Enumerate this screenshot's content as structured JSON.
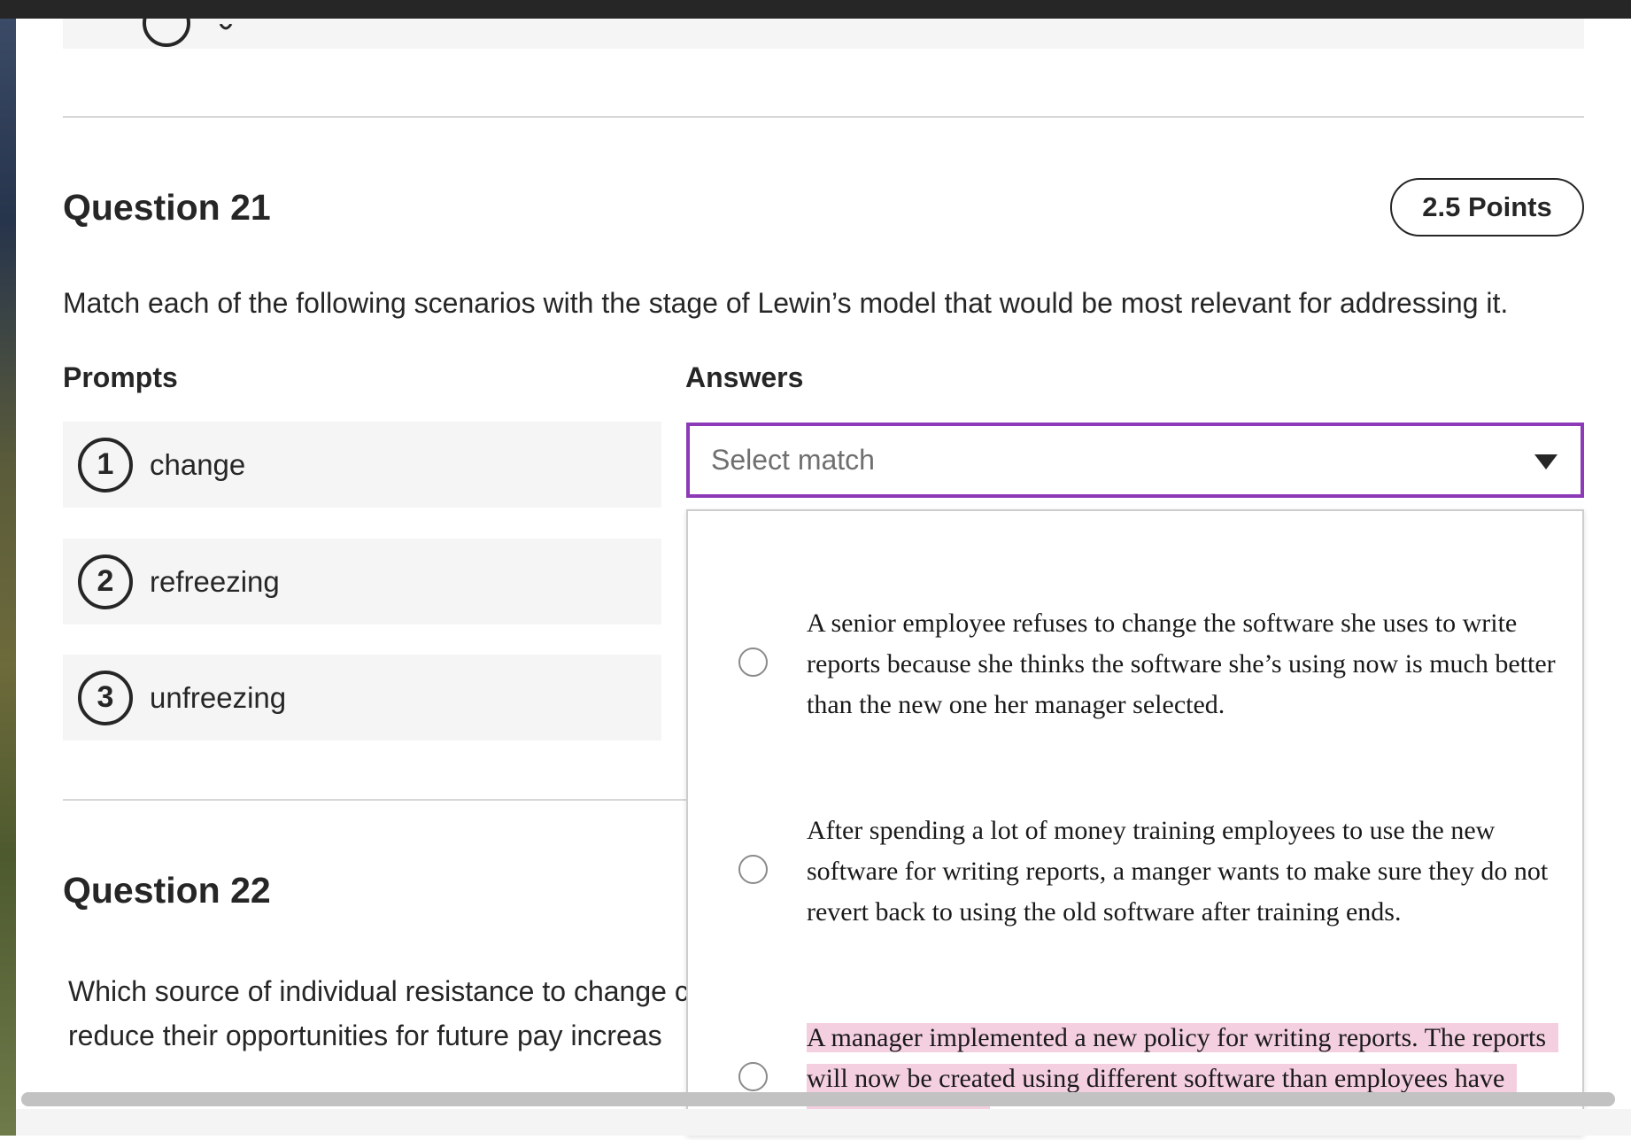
{
  "previous_question": {
    "circle_label": ""
  },
  "question21": {
    "title": "Question 21",
    "points": "2.5 Points",
    "text": "Match each of the following scenarios with the stage of Lewin’s model that would be most relevant for addressing it.",
    "prompts_header": "Prompts",
    "answers_header": "Answers",
    "prompts": [
      {
        "number": "1",
        "label": "change"
      },
      {
        "number": "2",
        "label": "refreezing"
      },
      {
        "number": "3",
        "label": "unfreezing"
      }
    ],
    "select": {
      "placeholder": "Select match",
      "state": "expanded"
    },
    "options": [
      {
        "text": "A senior employee refuses to change the software she uses to write reports because she thinks the software she’s using now is much better than the new one her manager selected.",
        "selected": false
      },
      {
        "text": "After spending a lot of money training employees to use the new software for writing reports, a manger wants to make sure they do not revert back to using the old software after training ends.",
        "selected": false
      },
      {
        "text": "A manager implemented a new policy for writing reports. The reports will now be created using different software than employees have used in the past.",
        "selected": false,
        "highlighted": true
      }
    ]
  },
  "question22": {
    "title": "Question 22",
    "text_line1": "Which source of individual resistance to change c",
    "text_line2": "reduce their opportunities for future pay increas"
  },
  "colors": {
    "accent_focus": "#8c3ab8",
    "highlight": "#f4cfe0",
    "card_bg": "#f5f5f5",
    "text": "#262626"
  },
  "icons": {
    "dropdown_caret": "caret-down-icon",
    "radio": "radio-unchecked-icon"
  }
}
